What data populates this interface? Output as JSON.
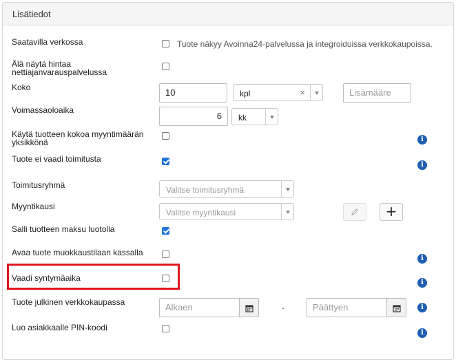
{
  "panel": {
    "title": "Lisätiedot"
  },
  "fields": {
    "saatavilla": {
      "label": "Saatavilla verkossa",
      "checked": false,
      "hint": "Tuote näkyy Avoinna24-palvelussa ja integroiduissa verkkokaupoissa."
    },
    "ala_nayta": {
      "label_line1": "Älä näytä hintaa",
      "label_line2": "nettiajanvarauspalvelussa",
      "checked": false
    },
    "koko": {
      "label": "Koko",
      "value": "10",
      "unit": "kpl",
      "extra_placeholder": "Lisämääre"
    },
    "voimassaolo": {
      "label": "Voimassaoloaika",
      "value": "6",
      "unit": "kk"
    },
    "kayta_kokoa": {
      "label_line1": "Käytä tuotteen kokoa myyntimäärän",
      "label_line2": "yksikkönä",
      "checked": false
    },
    "ei_toimitusta": {
      "label": "Tuote ei vaadi toimitusta",
      "checked": true
    },
    "toimitusryhma": {
      "label": "Toimitusryhmä",
      "placeholder": "Valitse toimitusryhmä"
    },
    "myyntikausi": {
      "label": "Myyntikausi",
      "placeholder": "Valitse myyntikausi"
    },
    "salli_luotolla": {
      "label": "Salli tuotteen maksu luotolla",
      "checked": true
    },
    "avaa_muokkaus": {
      "label": "Avaa tuote muokkaustilaan kassalla",
      "checked": false
    },
    "syntymaaika": {
      "label": "Vaadi syntymäaika",
      "checked": false
    },
    "julkinen": {
      "label": "Tuote julkinen verkkokaupassa",
      "start_placeholder": "Alkaen",
      "end_placeholder": "Päättyen",
      "separator": "-"
    },
    "pin": {
      "label": "Luo asiakkaalle PIN-koodi",
      "checked": false
    }
  },
  "icons": {
    "info": "info-icon",
    "edit": "pencil-icon",
    "add": "plus-icon",
    "calendar": "calendar-icon",
    "clear": "clear-x-icon",
    "dropdown": "chevron-down-icon"
  },
  "colors": {
    "accent": "#1e73d8",
    "info": "#1e5fb4",
    "highlight": "#e0151f"
  }
}
